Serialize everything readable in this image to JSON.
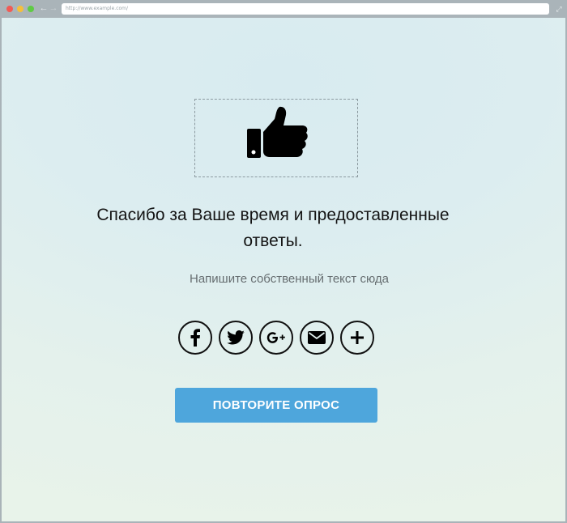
{
  "browser": {
    "address": "http://www.example.com/"
  },
  "icons": {
    "main": "thumbs-up-icon",
    "social": [
      "facebook-icon",
      "twitter-icon",
      "google-plus-icon",
      "email-icon",
      "plus-icon"
    ]
  },
  "content": {
    "headline_line1": "Спасибо за Ваше время и предоставленные",
    "headline_line2": "ответы.",
    "subtext": "Напишите собственный текст сюда",
    "retry_label": "ПОВТОРИТЕ ОПРОС"
  },
  "colors": {
    "button": "#4ea6dc",
    "text": "#141414"
  }
}
